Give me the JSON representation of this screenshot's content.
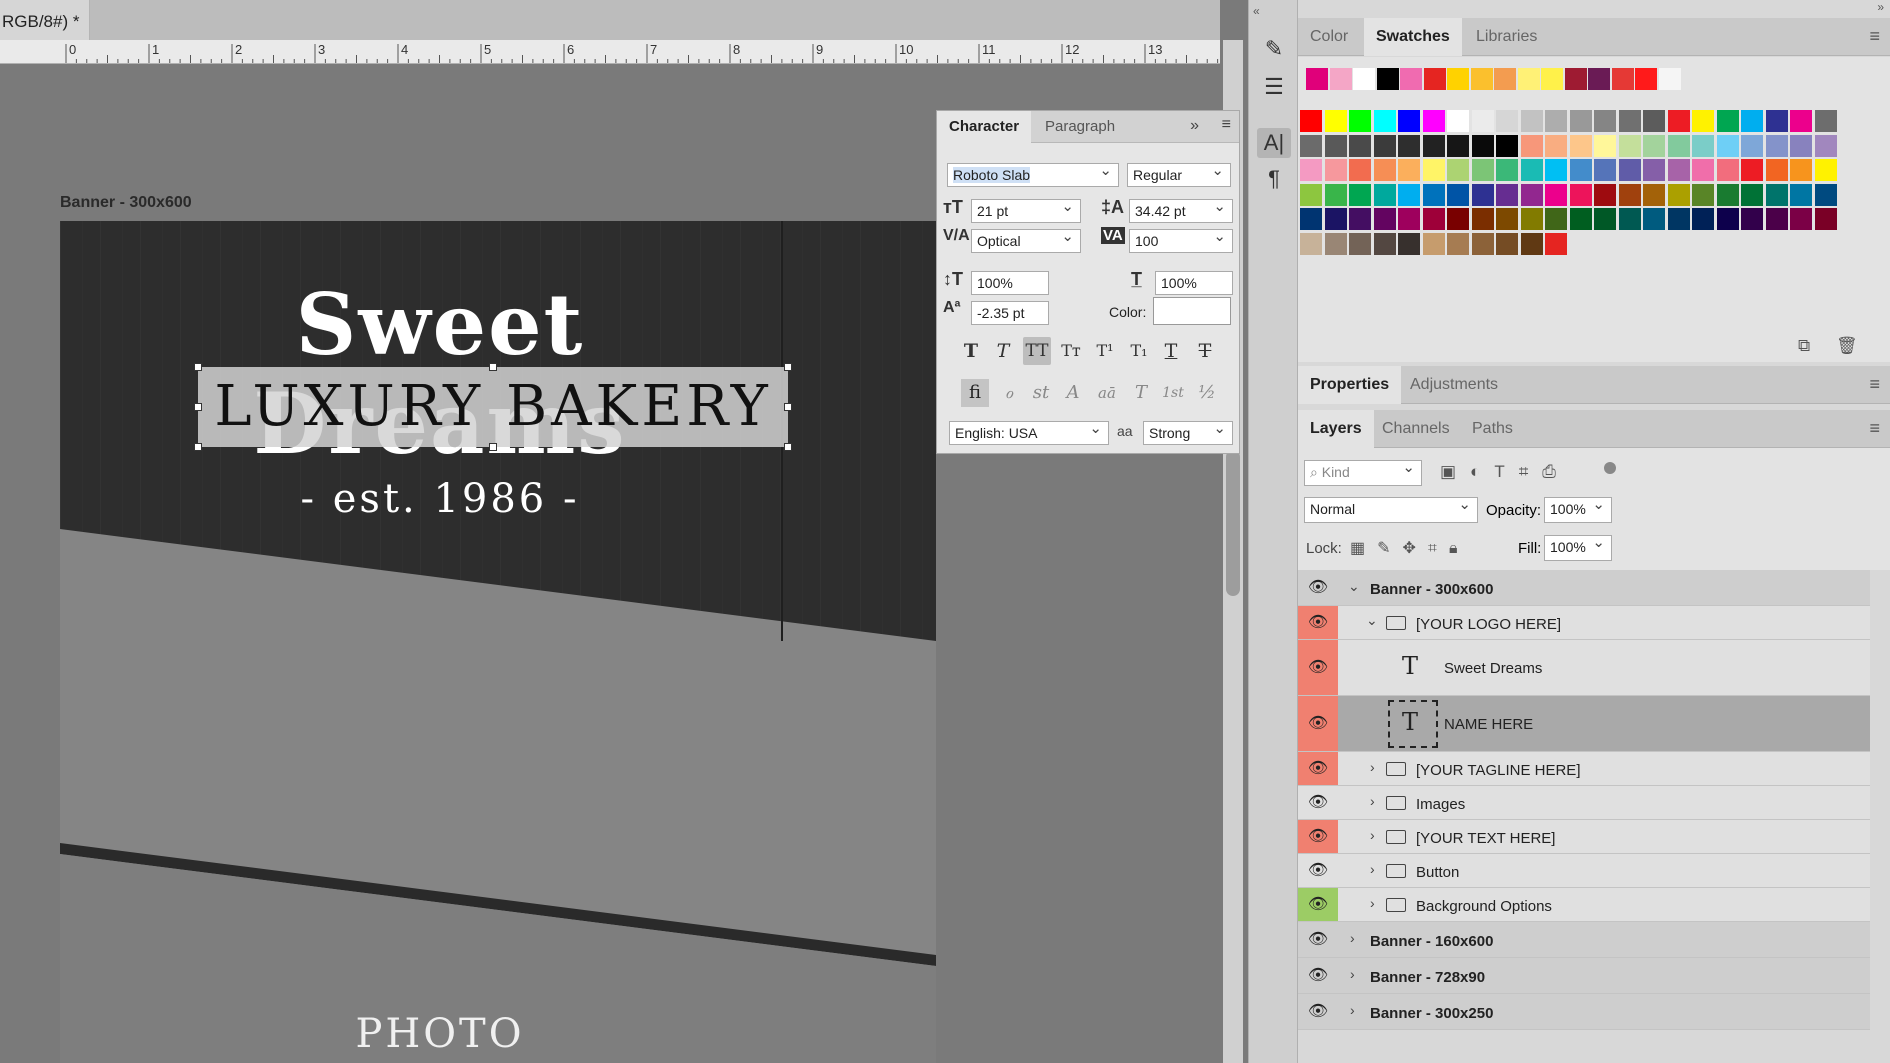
{
  "document": {
    "tab_label": "RGB/8#) *"
  },
  "ruler": {
    "marks": [
      "0",
      "1",
      "2",
      "3",
      "4",
      "5",
      "6",
      "7",
      "8",
      "9",
      "10",
      "11",
      "12",
      "13"
    ]
  },
  "artboard": {
    "label": "Banner - 300x600",
    "title": "Sweet Dreams",
    "subtitle": "LUXURY BAKERY",
    "tagline": "- est. 1986 -",
    "photo_text": "PHOTO"
  },
  "character_panel": {
    "tabs": [
      "Character",
      "Paragraph"
    ],
    "font_family": "Roboto Slab",
    "font_style": "Regular",
    "font_size": "21 pt",
    "leading": "34.42 pt",
    "kerning": "Optical",
    "tracking": "100",
    "vertical_scale": "100%",
    "horizontal_scale": "100%",
    "baseline_shift": "-2.35 pt",
    "color_label": "Color:",
    "language": "English: USA",
    "antialias_icon": "aa",
    "antialias": "Strong",
    "type_buttons": [
      "T",
      "T",
      "TT",
      "Tт",
      "T¹",
      "T₁",
      "T",
      "T"
    ],
    "opentype_buttons": [
      "fi",
      "ℴ",
      "st",
      "A",
      "aā",
      "T",
      "1st",
      "½"
    ]
  },
  "swatches_panel": {
    "tabs": [
      "Color",
      "Swatches",
      "Libraries"
    ],
    "recent": [
      "#e0007a",
      "#f4a6c6",
      "#ffffff",
      "#000000",
      "#f06bb0",
      "#e52521",
      "#ffd200",
      "#fbc02d",
      "#f39c50",
      "#fff176",
      "#fff14a",
      "#9e1b32",
      "#6a1b55",
      "#e53935",
      "#ff1a1a",
      "#f5f5f5"
    ],
    "rows": [
      [
        "#ff0000",
        "#ffff00",
        "#00ff00",
        "#00ffff",
        "#0000ff",
        "#ff00ff",
        "#ffffff",
        "#ebebeb",
        "#d6d6d6",
        "#c2c2c2",
        "#adadad",
        "#999999",
        "#858585",
        "#707070",
        "#5c5c5c",
        "#ed1c24",
        "#fff200",
        "#00a651",
        "#00aeef",
        "#2e3192",
        "#ec008c",
        "#6d6d6d"
      ],
      [
        "#6b6b6b",
        "#595959",
        "#4a4a4a",
        "#3b3b3b",
        "#2e2e2e",
        "#222222",
        "#161616",
        "#0a0a0a",
        "#000000",
        "#f7977a",
        "#f9ad81",
        "#fdc68a",
        "#fff79a",
        "#c4df9b",
        "#a3d39c",
        "#82ca9d",
        "#7bcdc8",
        "#6ecff6",
        "#7ea7d8",
        "#8493ca",
        "#8882be",
        "#a187be"
      ],
      [
        "#f49ac2",
        "#f6989d",
        "#f26c4f",
        "#f68e55",
        "#fbaf5c",
        "#fff467",
        "#acd372",
        "#7cc576",
        "#3bb878",
        "#1abbb4",
        "#00bff3",
        "#438ccb",
        "#5574b9",
        "#605ca8",
        "#855fa8",
        "#a763a8",
        "#f06eaa",
        "#f26d7d",
        "#ed1c24",
        "#f26522",
        "#f7941d",
        "#fff200"
      ],
      [
        "#8dc63f",
        "#39b54a",
        "#00a651",
        "#00a99d",
        "#00aeef",
        "#0072bc",
        "#0054a6",
        "#2e3192",
        "#662d91",
        "#92278f",
        "#ec008c",
        "#ed145b",
        "#9e0b0f",
        "#a0410d",
        "#a36209",
        "#aba000",
        "#598527",
        "#197b30",
        "#007236",
        "#00746b",
        "#0076a3",
        "#004a80"
      ],
      [
        "#003471",
        "#1b1464",
        "#440e62",
        "#630460",
        "#9e005d",
        "#9e0039",
        "#790000",
        "#7b2e00",
        "#7d4900",
        "#827b00",
        "#406618",
        "#005e20",
        "#005826",
        "#005952",
        "#005b7f",
        "#003663",
        "#002157",
        "#0d004c",
        "#32004b",
        "#4b0049",
        "#7b0046",
        "#7a0026"
      ],
      [
        "#c7b299",
        "#998675",
        "#736357",
        "#534741",
        "#37302d",
        "#c69c6d",
        "#a67c52",
        "#8c6239",
        "#754c24",
        "#603913",
        "#e52521"
      ]
    ]
  },
  "properties_panel": {
    "tabs": [
      "Properties",
      "Adjustments"
    ]
  },
  "layers_panel": {
    "tabs": [
      "Layers",
      "Channels",
      "Paths"
    ],
    "filter_placeholder": "Kind",
    "blend_mode": "Normal",
    "opacity_label": "Opacity:",
    "opacity": "100%",
    "lock_label": "Lock:",
    "fill_label": "Fill:",
    "fill": "100%",
    "layers": [
      {
        "name": "Banner - 300x600",
        "kind": "artboard",
        "expanded": true,
        "color": "none"
      },
      {
        "name": "[YOUR LOGO HERE]",
        "kind": "folder",
        "expanded": true,
        "color": "red"
      },
      {
        "name": "Sweet Dreams",
        "kind": "text",
        "color": "red"
      },
      {
        "name": "NAME HERE",
        "kind": "text",
        "selected": true,
        "color": "red"
      },
      {
        "name": "[YOUR TAGLINE HERE]",
        "kind": "folder",
        "color": "red"
      },
      {
        "name": "Images",
        "kind": "folder",
        "color": "none"
      },
      {
        "name": "[YOUR TEXT HERE]",
        "kind": "folder",
        "color": "red"
      },
      {
        "name": "Button",
        "kind": "folder",
        "color": "none"
      },
      {
        "name": "Background Options",
        "kind": "folder",
        "color": "green"
      },
      {
        "name": "Banner - 160x600",
        "kind": "artboard",
        "color": "none"
      },
      {
        "name": "Banner - 728x90",
        "kind": "artboard",
        "color": "none"
      },
      {
        "name": "Banner - 300x250",
        "kind": "artboard",
        "color": "none"
      }
    ]
  }
}
